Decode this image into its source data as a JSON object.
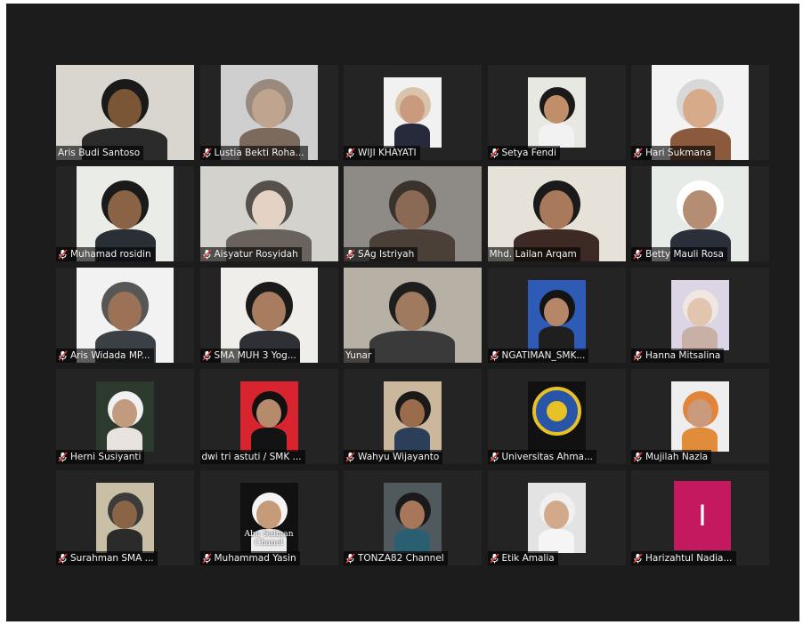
{
  "meeting": {
    "participants": [
      {
        "name": "Aris Budi Santoso",
        "muted": false,
        "video": "full",
        "bg": "#d9d6cf",
        "skin": "#7a5536",
        "shirt": "#2b2b2b",
        "cap": "#1a1a1a"
      },
      {
        "name": "Lustia Bekti Roha...",
        "muted": true,
        "video": "narrow",
        "bg": "#cfcfcf",
        "skin": "#bfa48f",
        "shirt": "#7c6a5c",
        "cap": "#9a8a7e"
      },
      {
        "name": "WIJI KHAYATI",
        "muted": true,
        "video": "mid",
        "bg": "#f1f1f1",
        "skin": "#c99a7d",
        "shirt": "#262a3a",
        "cap": "#d9c3a9"
      },
      {
        "name": "Setya Fendi",
        "muted": true,
        "video": "mid",
        "bg": "#e8e8e3",
        "skin": "#c08f6a",
        "shirt": "#f2f2f2",
        "cap": "#1a1a1a"
      },
      {
        "name": "Hari Sukmana",
        "muted": true,
        "video": "narrow",
        "bg": "#f3f3f3",
        "skin": "#d7ab8a",
        "shirt": "#8b5a3c",
        "cap": "#d8d8d8"
      },
      {
        "name": "Muhamad rosidin",
        "muted": true,
        "video": "narrow",
        "bg": "#e9ece7",
        "skin": "#8a6246",
        "shirt": "#2a2f35",
        "cap": "#1a1a1a"
      },
      {
        "name": "Aisyatur Rosyidah",
        "muted": true,
        "video": "full",
        "bg": "#d4d2cd",
        "skin": "#e4d2c4",
        "shirt": "#6a625c",
        "cap": "#555049"
      },
      {
        "name": "SAg Istriyah",
        "muted": true,
        "video": "full",
        "bg": "#8e8a85",
        "skin": "#8a6a55",
        "shirt": "#4a4038",
        "cap": "#3a332c"
      },
      {
        "name": "Mhd. Lailan Arqam",
        "muted": false,
        "video": "full",
        "bg": "#e6e2da",
        "skin": "#a8795a",
        "shirt": "#3d2a24",
        "cap": "#1a1a1a",
        "active": true
      },
      {
        "name": "Betty Mauli Rosa",
        "muted": true,
        "video": "narrow",
        "bg": "#e7ebe8",
        "skin": "#b58d72",
        "shirt": "#2b2f3a",
        "cap": "#ffffff"
      },
      {
        "name": "Aris Widada MP...",
        "muted": true,
        "video": "narrow",
        "bg": "#f2f2f2",
        "skin": "#9b7256",
        "shirt": "#3b3f46",
        "cap": "#575757"
      },
      {
        "name": "SMA MUH 3 Yog...",
        "muted": true,
        "video": "narrow",
        "bg": "#f0eeea",
        "skin": "#a87c5e",
        "shirt": "#2f3036",
        "cap": "#1a1a1a"
      },
      {
        "name": "Yunar",
        "muted": false,
        "video": "full",
        "bg": "#b7b0a5",
        "skin": "#9f7a5f",
        "shirt": "#3a3a3a",
        "cap": "#1e1e1e"
      },
      {
        "name": "NGATIMAN_SMK...",
        "muted": true,
        "video": "mid",
        "bg": "#2d5bb5",
        "skin": "#b58768",
        "shirt": "#1f1f1f",
        "cap": "#141414"
      },
      {
        "name": "Hanna Mitsalina",
        "muted": true,
        "video": "mid",
        "bg": "#dcd5e6",
        "skin": "#e2c5ae",
        "shirt": "#c9b0a6",
        "cap": "#f0e6e2"
      },
      {
        "name": "Herni Susiyanti",
        "muted": true,
        "video": "mid",
        "bg": "#2d3b2f",
        "skin": "#c29a7e",
        "shirt": "#e8e3df",
        "cap": "#f0f0f0"
      },
      {
        "name": "dwi tri astuti / SMK ...",
        "muted": false,
        "video": "mid",
        "bg": "#d8242e",
        "skin": "#b58b6c",
        "shirt": "#131313",
        "cap": "#111111"
      },
      {
        "name": "Wahyu Wijayanto",
        "muted": true,
        "video": "mid",
        "bg": "#cbb89c",
        "skin": "#9a6c4c",
        "shirt": "#2c3f5a",
        "cap": "#1a1a1a"
      },
      {
        "name": "Universitas Ahma...",
        "muted": true,
        "video": "seal",
        "bg": "#111111",
        "skin": "",
        "shirt": "",
        "cap": ""
      },
      {
        "name": "Mujilah Nazla",
        "muted": true,
        "video": "mid",
        "bg": "#eeeeee",
        "skin": "#c99a7b",
        "shirt": "#e08c3b",
        "cap": "#e2843a"
      },
      {
        "name": "Surahman SMA ...",
        "muted": true,
        "video": "mid",
        "bg": "#c9bfa6",
        "skin": "#8a6447",
        "shirt": "#2b2b2b",
        "cap": "#3b3b3b"
      },
      {
        "name": "Muhammad Yasin",
        "muted": true,
        "video": "mid",
        "bg": "#111111",
        "skin": "#c59b7a",
        "shirt": "#ededed",
        "cap": "#f4f4f4",
        "caption": "Abu Salman Chanel"
      },
      {
        "name": "TONZA82 Channel",
        "muted": true,
        "video": "mid",
        "bg": "#505a5e",
        "skin": "#a8775a",
        "shirt": "#2a5f72",
        "cap": "#1a1a1a"
      },
      {
        "name": "Etik Amalia",
        "muted": true,
        "video": "mid",
        "bg": "#e3e3e3",
        "skin": "#d3a98c",
        "shirt": "#f5f5f5",
        "cap": "#f0f0f0"
      },
      {
        "name": "Harizahtul Nadia...",
        "muted": true,
        "video": "initial",
        "initial": "I",
        "bg": "#c4195f"
      }
    ]
  },
  "colors": {
    "frame": "#1c1c1c",
    "tile": "#242424",
    "active_border": "#b7d83b",
    "muted_icon": "#e03a3a"
  }
}
